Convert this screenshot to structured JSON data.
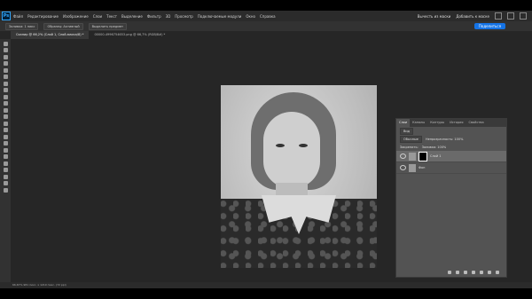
{
  "app": {
    "logo": "Ps"
  },
  "menu": [
    "Файл",
    "Редактирование",
    "Изображение",
    "Слои",
    "Текст",
    "Выделение",
    "Фильтр",
    "3D",
    "Просмотр",
    "Подключаемые модули",
    "Окно",
    "Справка"
  ],
  "menu_right": {
    "pill1": "Вычесть из маски",
    "pill2": "Добавить к маске"
  },
  "options": {
    "mode_label": "Заливка: 1 пикс",
    "sample": "Образец: Активный",
    "select_subject": "Выделить предмет",
    "share": "Поделиться"
  },
  "tabs": [
    "Сканир @ 66,2% (Слой 1, Слой-маска/8) *",
    "00000-4996754653.png @ 66,7% (RGB/8#) *"
  ],
  "status": {
    "text": "66,67%  981 пикс. x 1219 пикс. (72 ppi)"
  },
  "layers_panel": {
    "tabs": [
      "Слои",
      "Каналы",
      "Контуры",
      "История",
      "Свойства"
    ],
    "kind": "Вид",
    "blend": "Обычные",
    "opacity": "Непрозрачность: 100%",
    "lock": "Закрепить:",
    "fill": "Заливка: 100%",
    "layers": [
      {
        "name": "Слой 1",
        "active": true
      },
      {
        "name": "Фон",
        "active": false
      }
    ]
  }
}
